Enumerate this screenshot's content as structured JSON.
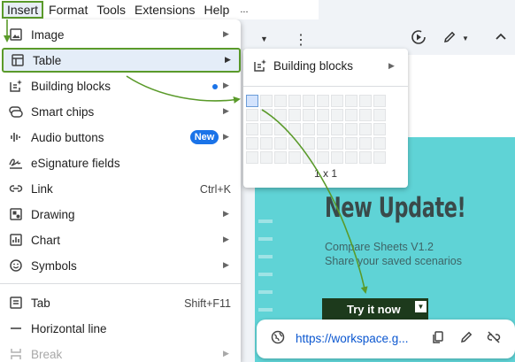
{
  "menubar": {
    "items": [
      "Insert",
      "Format",
      "Tools",
      "Extensions",
      "Help"
    ],
    "overflow": "..."
  },
  "insert_menu": {
    "items": [
      {
        "label": "Image",
        "icon": "image-icon",
        "submenu": true
      },
      {
        "label": "Table",
        "icon": "table-icon",
        "submenu": true,
        "highlighted": true
      },
      {
        "label": "Building blocks",
        "icon": "building-blocks-icon",
        "submenu": true,
        "dot": true
      },
      {
        "label": "Smart chips",
        "icon": "smart-chips-icon",
        "submenu": true
      },
      {
        "label": "Audio buttons",
        "icon": "audio-icon",
        "submenu": true,
        "badge": "New"
      },
      {
        "label": "eSignature fields",
        "icon": "signature-icon"
      },
      {
        "label": "Link",
        "icon": "link-icon",
        "shortcut": "Ctrl+K"
      },
      {
        "label": "Drawing",
        "icon": "drawing-icon",
        "submenu": true
      },
      {
        "label": "Chart",
        "icon": "chart-icon",
        "submenu": true
      },
      {
        "label": "Symbols",
        "icon": "symbols-icon",
        "submenu": true
      },
      {
        "label": "Tab",
        "icon": "tab-icon",
        "shortcut": "Shift+F11"
      },
      {
        "label": "Horizontal line",
        "icon": "horizontal-line-icon"
      },
      {
        "label": "Break",
        "icon": "break-icon",
        "submenu": true,
        "disabled": true
      }
    ]
  },
  "table_submenu": {
    "building_blocks_label": "Building blocks",
    "grid_columns": 10,
    "grid_rows": 5,
    "selected_columns": 1,
    "selected_rows": 1,
    "size_label": "1 x 1"
  },
  "document": {
    "headline": "New Update!",
    "sub_line1": "Compare Sheets V1.2",
    "sub_line2": "Share your saved scenarios",
    "cta_label": "Try it now"
  },
  "link_chip": {
    "url": "https://workspace.g..."
  },
  "colors": {
    "highlight_border": "#5a9a2a",
    "teal_background": "#5fd3d6",
    "accent_blue": "#1a73e8",
    "annotation_arrow": "#5a9a2a"
  }
}
